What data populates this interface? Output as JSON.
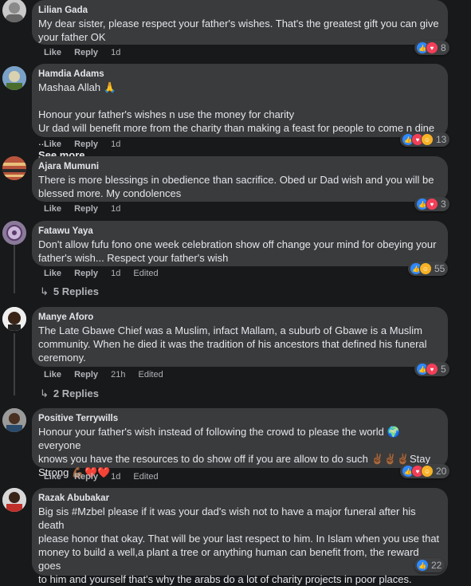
{
  "comments": [
    {
      "name": "Lilian Gada",
      "text": "My dear sister, please respect your father's wishes. That's the greatest gift you can give\nyour father OK",
      "like": "Like",
      "reply": "Reply",
      "time": "1d",
      "reactions": "8"
    },
    {
      "name": "Hamdia Adams",
      "text": "Mashaa Allah 🙏\n\nHonour your father's wishes n use the money for charity\nUr dad will benefit more from the charity than making a feast for people to come n dine ...",
      "see_more": "See more",
      "like": "Like",
      "reply": "Reply",
      "time": "1d",
      "reactions": "13"
    },
    {
      "name": "Ajara Mumuni",
      "text": "There is more blessings in obedience than sacrifice. Obed ur Dad wish and you will be\nblessed more. My condolences",
      "like": "Like",
      "reply": "Reply",
      "time": "1d",
      "reactions": "3"
    },
    {
      "name": "Fatawu Yaya",
      "text": "Don't allow fufu fono one week celebration show off change your mind for obeying your\nfather's wish... Respect your father's wish",
      "like": "Like",
      "reply": "Reply",
      "time": "1d",
      "edited": "Edited",
      "reactions": "55",
      "replies": "5 Replies"
    },
    {
      "name": "Manye Aforo",
      "text": "The Late Gbawe Chief was a Muslim, infact Mallam, a suburb of Gbawe is a Muslim\ncommunity. When he died it was the tradition of his ancestors that defined his funeral\nceremony.",
      "like": "Like",
      "reply": "Reply",
      "time": "21h",
      "edited": "Edited",
      "reactions": "5",
      "replies": "2 Replies"
    },
    {
      "name": "Positive Terrywills",
      "text": "Honour your father's wish instead of following the crowd to please the world 🌍 everyone\nknows you have the resources to do show off if you are allow to do such ✌🏾✌🏾✌🏾Stay\nStrong 💪🏾❤️❤️",
      "like": "Like",
      "reply": "Reply",
      "time": "1d",
      "edited": "Edited",
      "reactions": "20"
    },
    {
      "name": "Razak Abubakar",
      "text": "Big sis #Mzbel please if it was your dad's wish not to have a major funeral after his death\nplease honor that okay. That will be your last respect to him. In Islam when you use that\nmoney to build a well,a plant a tree or anything human can benefit from, the reward goes\nto him and yourself that's why the arabs do a lot of charity projects in poor places.",
      "reactions": "22"
    }
  ],
  "colors": {
    "background": "#18191a",
    "bubble": "#3a3b3c",
    "like_blue": "#2d88ff",
    "love_red": "#f33e58",
    "haha_yellow": "#f7b125"
  },
  "icons": {
    "like": "thumbs-up-icon",
    "love": "heart-icon",
    "haha": "laughing-face-icon",
    "reply_arrow": "reply-arrow-icon"
  }
}
